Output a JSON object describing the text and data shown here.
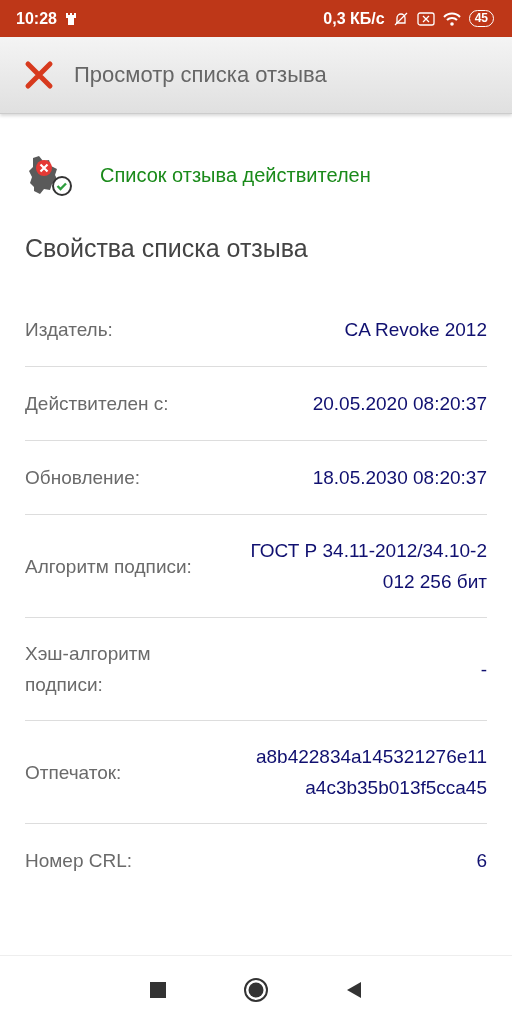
{
  "status_bar": {
    "time": "10:28",
    "speed": "0,3 КБ/с",
    "battery": "45"
  },
  "toolbar": {
    "title": "Просмотр списка отзыва"
  },
  "status": {
    "text": "Список отзыва действителен"
  },
  "section_title": "Свойства списка отзыва",
  "properties": [
    {
      "label": "Издатель:",
      "value": "CA Revoke 2012"
    },
    {
      "label": "Действителен с:",
      "value": "20.05.2020 08:20:37"
    },
    {
      "label": "Обновление:",
      "value": "18.05.2030 08:20:37"
    },
    {
      "label": "Алгоритм подписи:",
      "value": "ГОСТ Р 34.11-2012/34.10-2012 256 бит"
    },
    {
      "label": "Хэш-алгоритм подписи:",
      "value": "-"
    },
    {
      "label": "Отпечаток:",
      "value": "a8b422834a145321276e11a4c3b35b013f5cca45"
    },
    {
      "label": "Номер CRL:",
      "value": "6"
    }
  ]
}
